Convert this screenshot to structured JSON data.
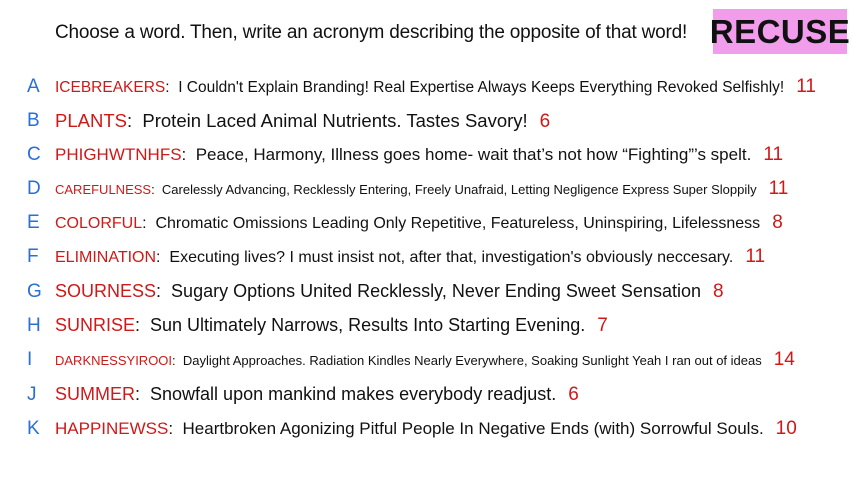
{
  "prompt": "Choose a word. Then, write an acronym describing the opposite of that word!",
  "badge": "RECUSE",
  "entries": [
    {
      "letter": "A",
      "word": "ICEBREAKERS",
      "desc": "I Couldn't Explain Branding! Real Expertise Always Keeps Everything Revoked Selfishly!",
      "count": "11"
    },
    {
      "letter": "B",
      "word": "PLANTS",
      "desc": "Protein Laced Animal Nutrients. Tastes Savory!",
      "count": "6"
    },
    {
      "letter": "C",
      "word": "PHIGHWTNHFS",
      "desc": "Peace, Harmony, Illness goes home- wait that’s not how “Fighting”’s spelt.",
      "count": "11"
    },
    {
      "letter": "D",
      "word": "CAREFULNESS",
      "desc": "Carelessly Advancing, Recklessly Entering, Freely Unafraid, Letting Negligence Express Super Sloppily",
      "count": "11"
    },
    {
      "letter": "E",
      "word": "COLORFUL",
      "desc": "Chromatic Omissions Leading Only Repetitive, Featureless, Uninspiring, Lifelessness",
      "count": "8"
    },
    {
      "letter": "F",
      "word": "ELIMINATION",
      "desc": "Executing lives? I must insist not, after that, investigation's obviously neccesary.",
      "count": "11"
    },
    {
      "letter": "G",
      "word": "SOURNESS",
      "desc": "Sugary Options United Recklessly, Never Ending Sweet Sensation",
      "count": "8"
    },
    {
      "letter": "H",
      "word": "SUNRISE",
      "desc": "Sun Ultimately Narrows, Results Into Starting Evening.",
      "count": "7"
    },
    {
      "letter": "I",
      "word": "DARKNESSYIROOI",
      "desc": "Daylight Approaches. Radiation Kindles Nearly Everywhere, Soaking Sunlight Yeah I ran out of ideas",
      "count": "14"
    },
    {
      "letter": "J",
      "word": "SUMMER",
      "desc": "Snowfall upon mankind makes everybody readjust.",
      "count": "6"
    },
    {
      "letter": "K",
      "word": "HAPPINEWSS",
      "desc": "Heartbroken Agonizing Pitful People In Negative Ends (with) Sorrowful Souls.",
      "count": "10"
    }
  ]
}
